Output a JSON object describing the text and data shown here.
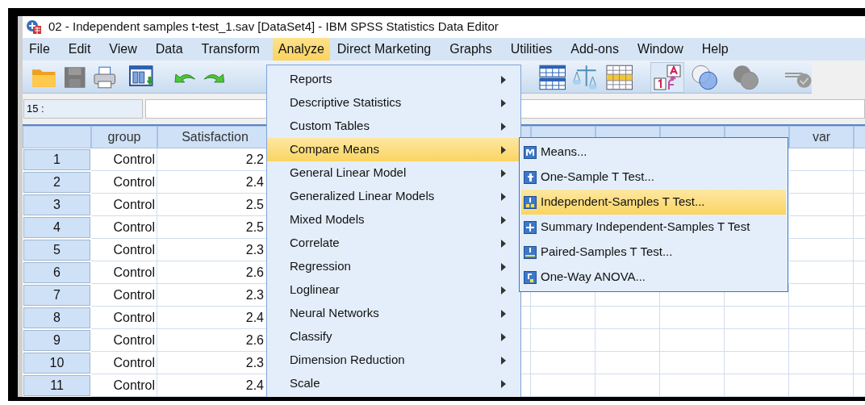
{
  "window": {
    "title": "02 - Independent samples t-test_1.sav [DataSet4] - IBM SPSS Statistics Data Editor"
  },
  "menubar": [
    {
      "label": "File",
      "selected": false
    },
    {
      "label": "Edit",
      "selected": false
    },
    {
      "label": "View",
      "selected": false
    },
    {
      "label": "Data",
      "selected": false
    },
    {
      "label": "Transform",
      "selected": false
    },
    {
      "label": "Analyze",
      "selected": true
    },
    {
      "label": "Direct Marketing",
      "selected": false
    },
    {
      "label": "Graphs",
      "selected": false
    },
    {
      "label": "Utilities",
      "selected": false
    },
    {
      "label": "Add-ons",
      "selected": false
    },
    {
      "label": "Window",
      "selected": false
    },
    {
      "label": "Help",
      "selected": false
    }
  ],
  "cell_reference": "15 :",
  "table": {
    "columns": [
      "group",
      "Satisfaction",
      "var"
    ],
    "rows": [
      {
        "number": "1",
        "group": "Control",
        "satisfaction": "2.2"
      },
      {
        "number": "2",
        "group": "Control",
        "satisfaction": "2.4"
      },
      {
        "number": "3",
        "group": "Control",
        "satisfaction": "2.5"
      },
      {
        "number": "4",
        "group": "Control",
        "satisfaction": "2.5"
      },
      {
        "number": "5",
        "group": "Control",
        "satisfaction": "2.3"
      },
      {
        "number": "6",
        "group": "Control",
        "satisfaction": "2.6"
      },
      {
        "number": "7",
        "group": "Control",
        "satisfaction": "2.3"
      },
      {
        "number": "8",
        "group": "Control",
        "satisfaction": "2.4"
      },
      {
        "number": "9",
        "group": "Control",
        "satisfaction": "2.6"
      },
      {
        "number": "10",
        "group": "Control",
        "satisfaction": "2.3"
      },
      {
        "number": "11",
        "group": "Control",
        "satisfaction": "2.4"
      }
    ]
  },
  "analyze_menu": [
    {
      "label": "Reports",
      "selected": false
    },
    {
      "label": "Descriptive Statistics",
      "selected": false
    },
    {
      "label": "Custom Tables",
      "selected": false
    },
    {
      "label": "Compare Means",
      "selected": true
    },
    {
      "label": "General Linear Model",
      "selected": false
    },
    {
      "label": "Generalized Linear Models",
      "selected": false
    },
    {
      "label": "Mixed Models",
      "selected": false
    },
    {
      "label": "Correlate",
      "selected": false
    },
    {
      "label": "Regression",
      "selected": false
    },
    {
      "label": "Loglinear",
      "selected": false
    },
    {
      "label": "Neural Networks",
      "selected": false
    },
    {
      "label": "Classify",
      "selected": false
    },
    {
      "label": "Dimension Reduction",
      "selected": false
    },
    {
      "label": "Scale",
      "selected": false
    }
  ],
  "compare_means_menu": [
    {
      "label": "Means...",
      "kind": "means",
      "selected": false
    },
    {
      "label": "One-Sample T Test...",
      "kind": "t",
      "selected": false
    },
    {
      "label": "Independent-Samples T Test...",
      "kind": "t_groups",
      "selected": true
    },
    {
      "label": "Summary Independent-Samples T Test",
      "kind": "plus",
      "selected": false
    },
    {
      "label": "Paired-Samples T Test...",
      "kind": "t_paired",
      "selected": false
    },
    {
      "label": "One-Way ANOVA...",
      "kind": "anova",
      "selected": false
    }
  ]
}
